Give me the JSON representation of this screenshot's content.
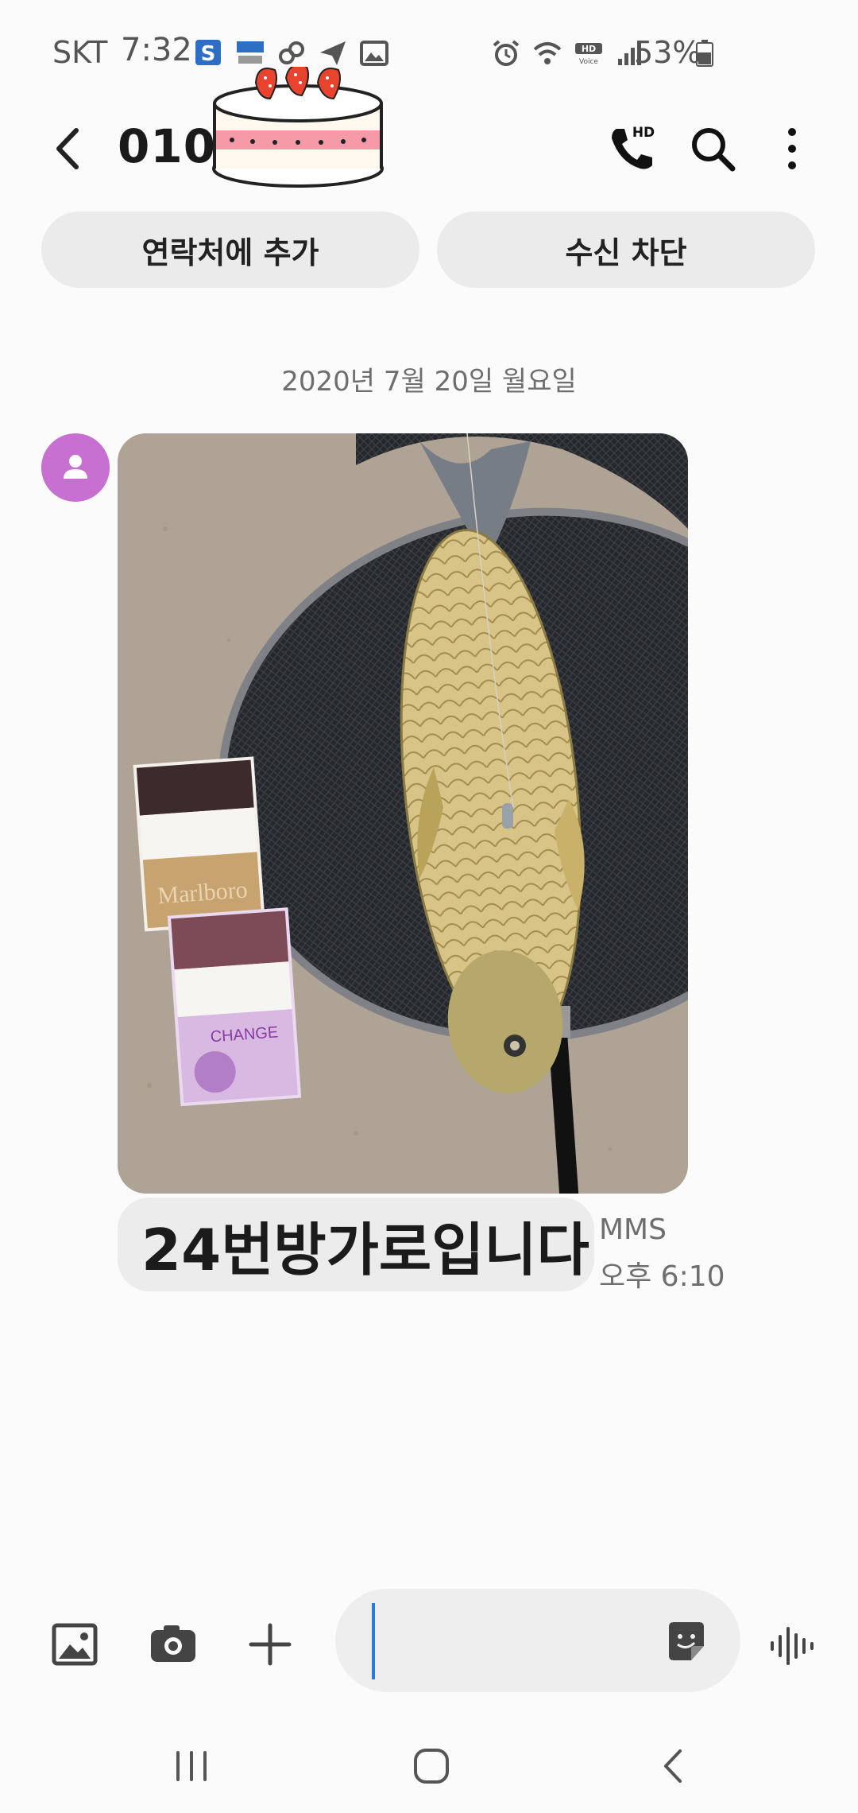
{
  "status_bar": {
    "carrier": "SKT",
    "time": "7:32",
    "battery": "53%",
    "left_icons": [
      "s-app-icon",
      "tv-app-icon",
      "link-icon",
      "send-icon",
      "image-icon"
    ],
    "right_icons": [
      "alarm-icon",
      "wifi-icon",
      "hd-voice-icon",
      "signal-icon",
      "battery-icon"
    ]
  },
  "header": {
    "title": "010-8      3",
    "back_icon": "chevron-left-icon",
    "actions": [
      "hd-call-icon",
      "search-icon",
      "more-vertical-icon"
    ]
  },
  "actions": {
    "add_contact": "연락처에 추가",
    "block": "수신 차단"
  },
  "conversation": {
    "date_divider": "2020년 7월 20일 월요일",
    "messages": [
      {
        "type_label": "MMS",
        "time": "오후 6:10",
        "text": "24번방가로입니다",
        "has_photo": true
      }
    ]
  },
  "composer": {
    "value": "",
    "placeholder": ""
  },
  "colors": {
    "background": "#fbfbfb",
    "pill": "#ebebeb",
    "avatar": "#c86fd2",
    "cursor": "#2b7bd6"
  }
}
